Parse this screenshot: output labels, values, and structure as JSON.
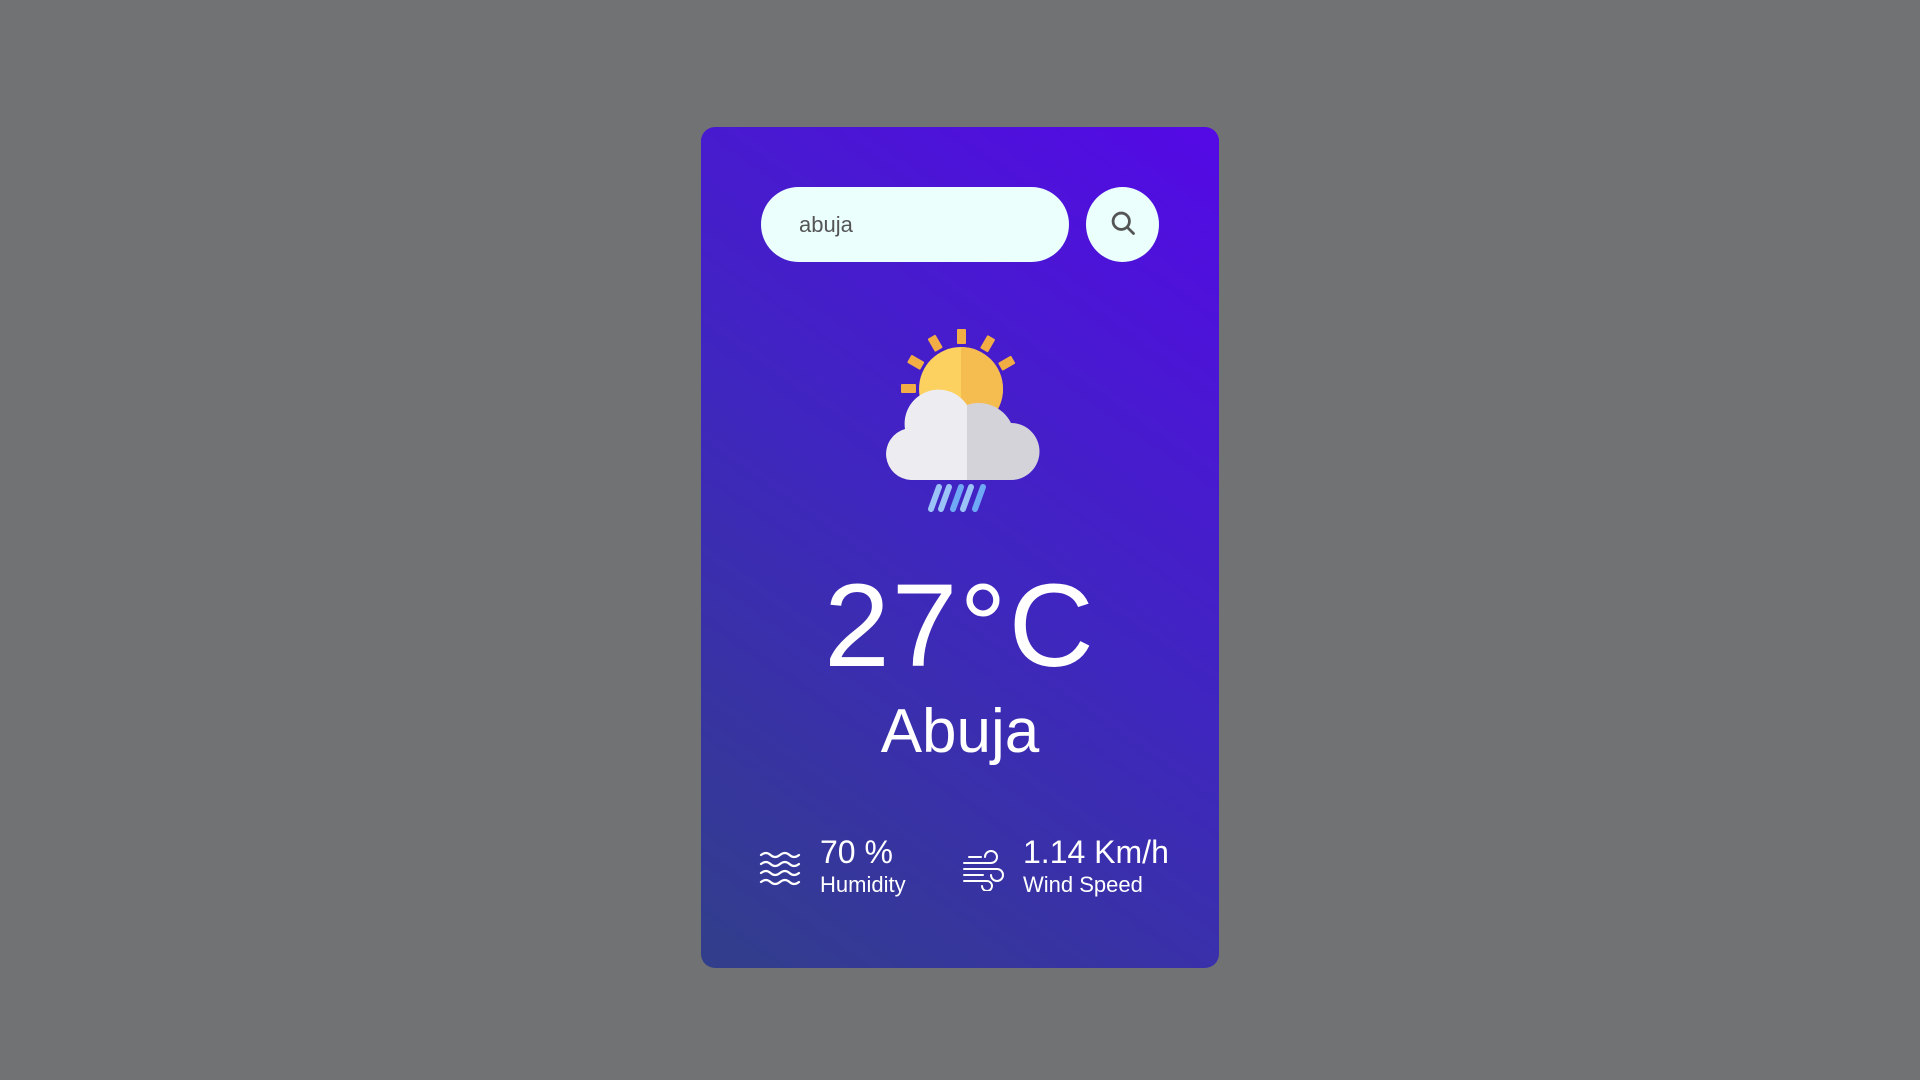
{
  "search": {
    "value": "abuja",
    "icon": "search-icon"
  },
  "weather": {
    "icon": "sun-cloud-rain-icon",
    "temperature": "27°C",
    "city": "Abuja"
  },
  "details": {
    "humidity": {
      "icon": "humidity-waves-icon",
      "value": "70 %",
      "label": "Humidity"
    },
    "wind": {
      "icon": "wind-icon",
      "value": "1.14 Km/h",
      "label": "Wind Speed"
    }
  },
  "colors": {
    "background": "#717274",
    "card_gradient_start": "#5409e6",
    "card_gradient_end": "#313f8a",
    "input_background": "#ebfffc",
    "text": "#ffffff",
    "sun": "#fcd15f",
    "cloud": "#ededf1",
    "rain": "#6fa8f5"
  }
}
